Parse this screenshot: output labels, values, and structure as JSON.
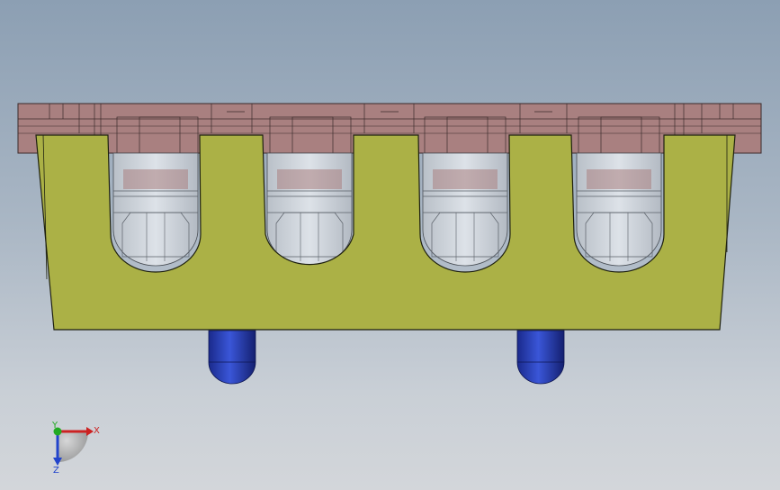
{
  "viewport": {
    "background_top": "#8c9fb3",
    "background_bottom": "#d3d6da"
  },
  "model": {
    "top_plate_color": "#a98080",
    "yellow_block_color": "#abb146",
    "nut_color": "#c5cbd3",
    "pin_color": "#2233a8",
    "slot_count": 4,
    "pin_count": 2
  },
  "triad": {
    "x_label": "X",
    "y_label": "Y",
    "z_label": "Z",
    "x_color": "#cc2222",
    "y_color": "#22aa22",
    "z_color": "#2244cc"
  }
}
